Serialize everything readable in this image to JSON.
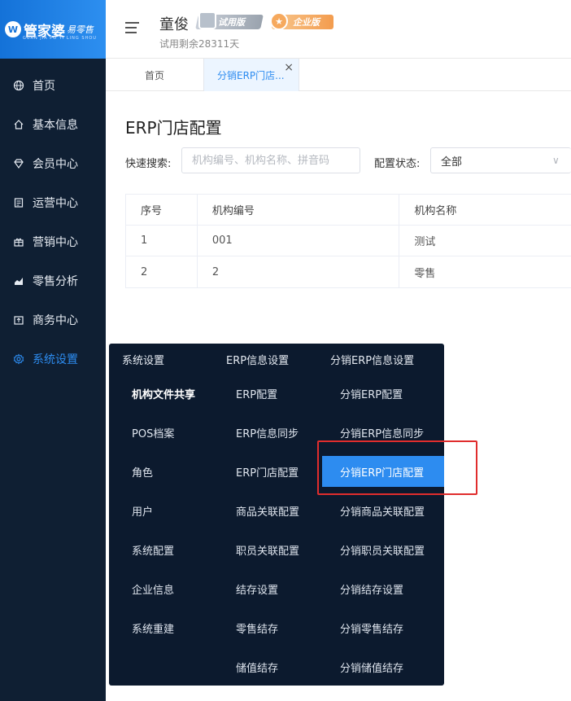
{
  "logo": {
    "name": "管家婆",
    "sub": "易零售",
    "tagline": "GUAN JIA PO YI LING SHOU"
  },
  "sidebar": {
    "items": [
      {
        "label": "首页",
        "icon": "globe-icon"
      },
      {
        "label": "基本信息",
        "icon": "home-icon"
      },
      {
        "label": "会员中心",
        "icon": "diamond-icon"
      },
      {
        "label": "运营中心",
        "icon": "document-icon"
      },
      {
        "label": "营销中心",
        "icon": "gift-icon"
      },
      {
        "label": "零售分析",
        "icon": "chart-icon"
      },
      {
        "label": "商务中心",
        "icon": "upload-box-icon"
      },
      {
        "label": "系统设置",
        "icon": "gear-icon"
      }
    ],
    "active_index": 7
  },
  "header": {
    "user_name": "童俊",
    "trial_badge": "试用版",
    "enterprise_badge": "企业版",
    "trial_remain": "试用剩余28311天"
  },
  "tabs": [
    {
      "label": "首页"
    },
    {
      "label": "分销ERP门店..."
    }
  ],
  "page": {
    "title": "ERP门店配置",
    "search_label": "快速搜索:",
    "search_placeholder": "机构编号、机构名称、拼音码",
    "status_label": "配置状态:",
    "status_value": "全部"
  },
  "table": {
    "headers": [
      "序号",
      "机构编号",
      "机构名称"
    ],
    "rows": [
      [
        "1",
        "001",
        "测试"
      ],
      [
        "2",
        "2",
        "零售"
      ]
    ]
  },
  "mega_menu": {
    "col1": {
      "title": "系统设置",
      "items": [
        "机构文件共享",
        "POS档案",
        "角色",
        "用户",
        "系统配置",
        "企业信息",
        "系统重建"
      ]
    },
    "col2": {
      "title": "ERP信息设置",
      "items": [
        "ERP配置",
        "ERP信息同步",
        "ERP门店配置",
        "商品关联配置",
        "职员关联配置",
        "结存设置",
        "零售结存",
        "储值结存"
      ]
    },
    "col3": {
      "title": "分销ERP信息设置",
      "items": [
        "分销ERP配置",
        "分销ERP信息同步",
        "分销ERP门店配置",
        "分销商品关联配置",
        "分销职员关联配置",
        "分销结存设置",
        "分销零售结存",
        "分销储值结存"
      ],
      "active_index": 2
    }
  },
  "colors": {
    "sidebar_bg": "#0f1f33",
    "accent": "#2d8cf0",
    "highlight_border": "#e02d2d"
  }
}
